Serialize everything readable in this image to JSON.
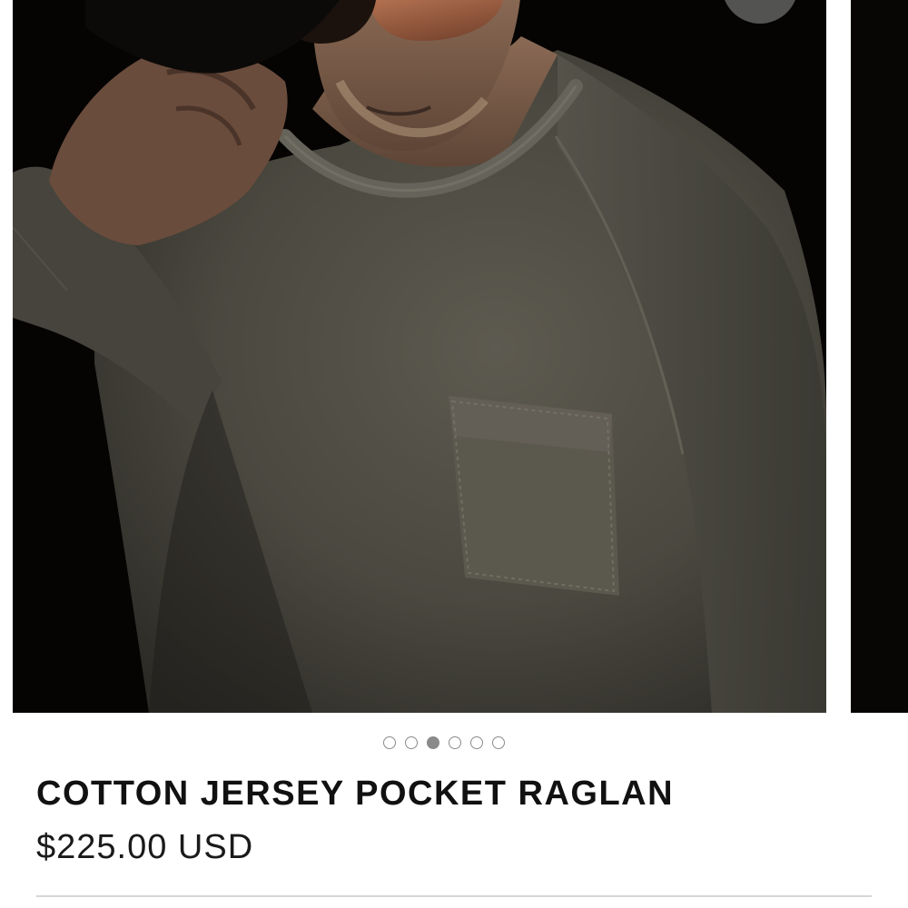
{
  "product": {
    "title": "COTTON JERSEY POCKET RAGLAN",
    "price": "$225.00 USD",
    "image_subject": "Man in olive-grey cotton jersey pocket raglan, wearing sunglasses, hand at brim"
  },
  "gallery": {
    "slide_count": 6,
    "active_index": 2
  },
  "colors": {
    "background": "#ffffff",
    "photo_backdrop": "#050403",
    "shirt": "#4f4d44",
    "text": "#111111",
    "dot": "#8a8a8a",
    "divider": "#d6d6d6"
  },
  "icons": {
    "gallery_nav": "circle-button-icon"
  }
}
